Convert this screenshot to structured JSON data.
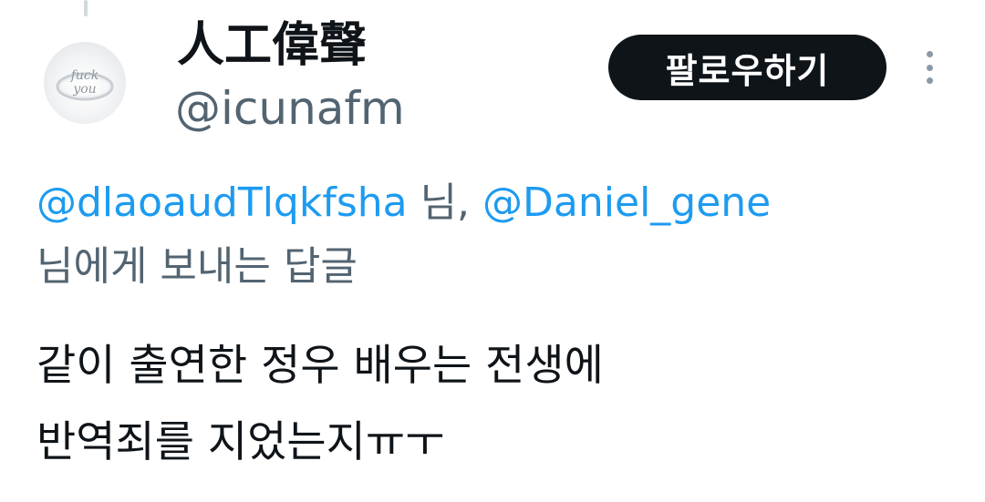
{
  "author": {
    "display_name": "人工偉聲",
    "handle": "@icunafm",
    "avatar_text": "fuck you"
  },
  "actions": {
    "follow_label": "팔로우하기",
    "more_icon": "more-vertical-icon"
  },
  "reply_context": {
    "mention_1": "@dlaoaudTlqkfsha",
    "separator": " 님, ",
    "mention_2": "@Daniel_gene",
    "suffix": "님에게 보내는 답글"
  },
  "tweet": {
    "lines": [
      "같이 출연한 정우 배우는 전생에",
      "반역죄를 지었는지ㅠㅜ"
    ]
  },
  "colors": {
    "link": "#1d9bf0",
    "secondary_text": "#536471",
    "primary_text": "#0f1419",
    "button_bg": "#0f1419"
  }
}
